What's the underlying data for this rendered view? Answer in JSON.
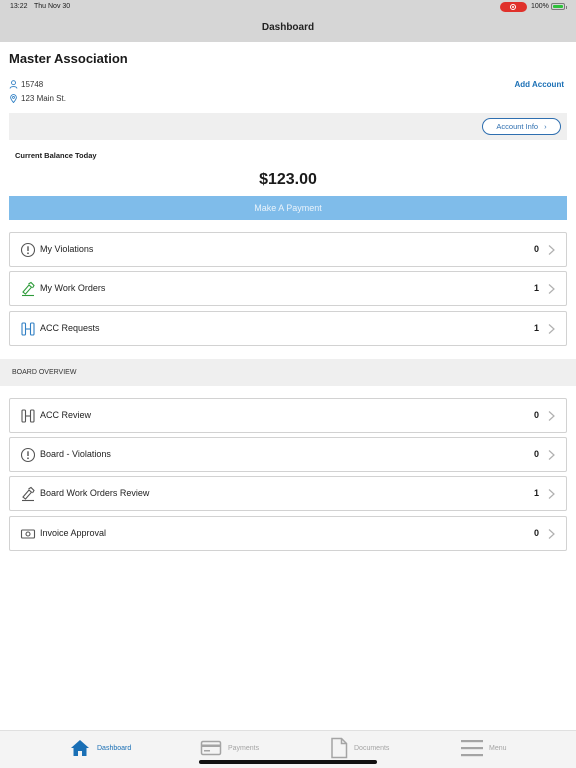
{
  "status_bar": {
    "time": "13:22",
    "date": "Thu Nov 30",
    "battery": "100%"
  },
  "nav": {
    "title": "Dashboard"
  },
  "account": {
    "name": "Master Association",
    "id": "15748",
    "address": "123 Main St.",
    "add_account": "Add Account",
    "account_info": "Account Info"
  },
  "balance": {
    "label": "Current Balance Today",
    "amount": "$123.00"
  },
  "pay_button": "Make A Payment",
  "my_items": [
    {
      "label": "My Violations",
      "count": "0",
      "icon": "alert-icon"
    },
    {
      "label": "My Work Orders",
      "count": "1",
      "icon": "hammer-icon"
    },
    {
      "label": "ACC Requests",
      "count": "1",
      "icon": "acc-icon"
    }
  ],
  "board": {
    "heading": "BOARD OVERVIEW",
    "items": [
      {
        "label": "ACC Review",
        "count": "0",
        "icon": "acc-icon"
      },
      {
        "label": "Board - Violations",
        "count": "0",
        "icon": "alert-icon"
      },
      {
        "label": "Board Work Orders Review",
        "count": "1",
        "icon": "hammer-icon"
      },
      {
        "label": "Invoice Approval",
        "count": "0",
        "icon": "money-icon"
      }
    ]
  },
  "tabs": [
    {
      "label": "Dashboard",
      "icon": "home-icon",
      "active": true
    },
    {
      "label": "Payments",
      "icon": "card-icon",
      "active": false
    },
    {
      "label": "Documents",
      "icon": "document-icon",
      "active": false
    },
    {
      "label": "Menu",
      "icon": "menu-icon",
      "active": false
    }
  ],
  "colors": {
    "accent": "#1a6fb5",
    "pay_button": "#7fbcea",
    "work_order_icon": "#2e9b3a",
    "recording": "#e0312b"
  }
}
